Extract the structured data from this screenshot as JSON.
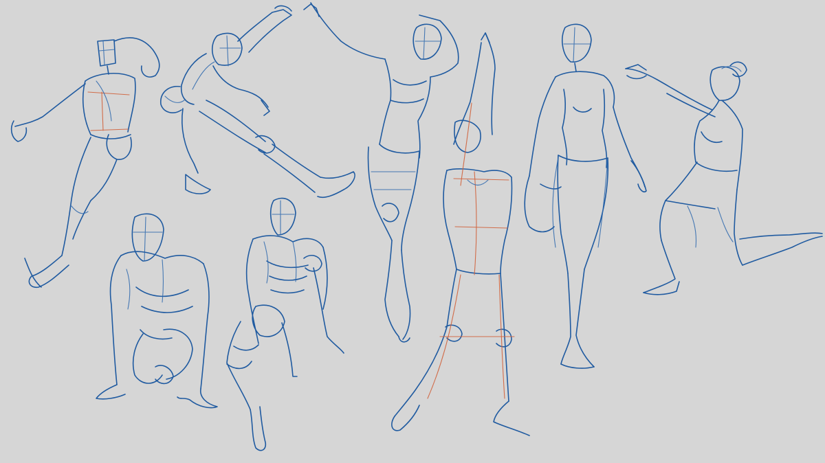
{
  "canvas": {
    "background": "#d6d6d6",
    "ink_color": "#1f5aa0",
    "construction_color": "#d0603a"
  },
  "figures": [
    {
      "id": "figure-1",
      "pose": "running-lunge"
    },
    {
      "id": "figure-2",
      "pose": "flying-kick"
    },
    {
      "id": "figure-3",
      "pose": "crouching-male"
    },
    {
      "id": "figure-4",
      "pose": "seated-male"
    },
    {
      "id": "figure-5",
      "pose": "leaping-arms-raised"
    },
    {
      "id": "figure-6",
      "pose": "standing-arms-overhead"
    },
    {
      "id": "figure-7",
      "pose": "standing-leg-raised"
    },
    {
      "id": "figure-8",
      "pose": "kneeling-reaching"
    }
  ]
}
